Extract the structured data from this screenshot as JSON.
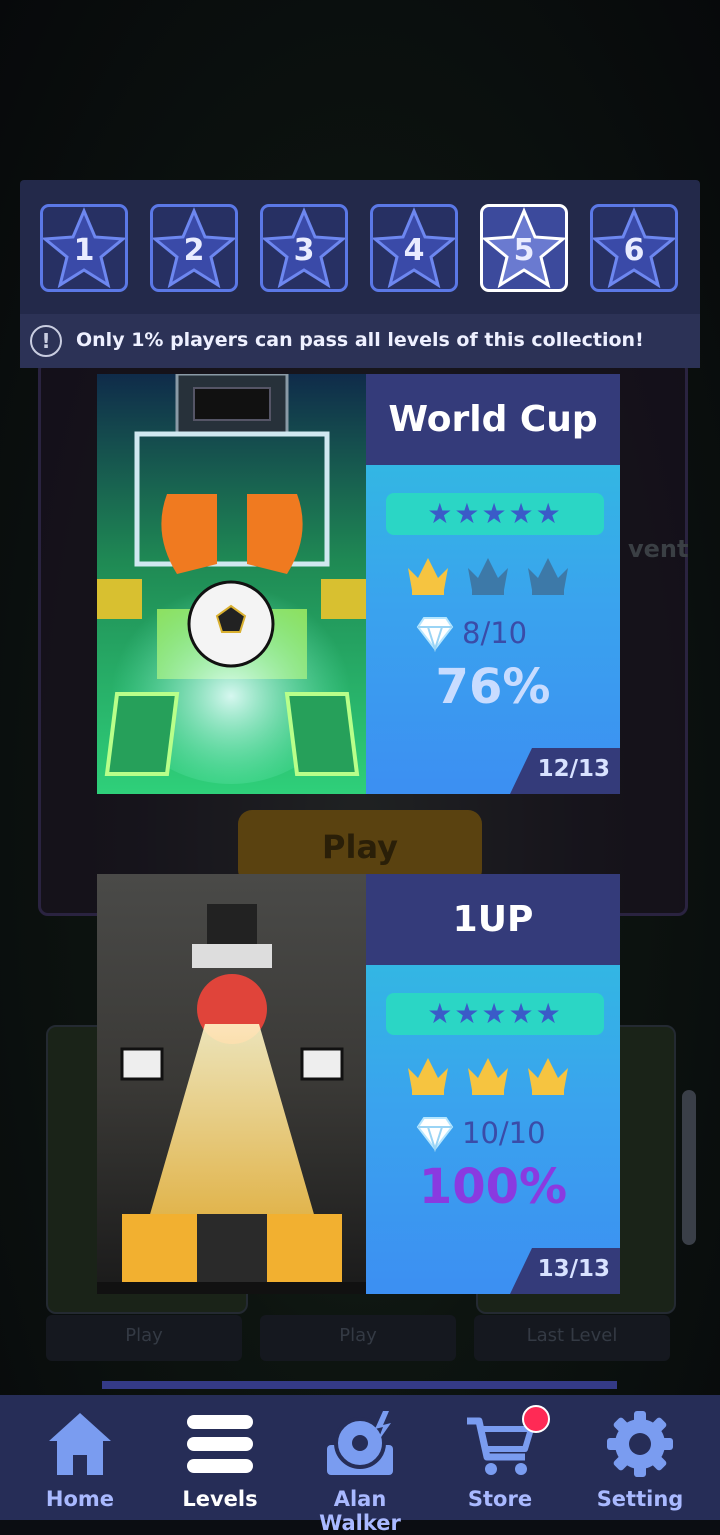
{
  "collections": {
    "tabs": [
      {
        "label": "1",
        "active": false
      },
      {
        "label": "2",
        "active": false
      },
      {
        "label": "3",
        "active": false
      },
      {
        "label": "4",
        "active": false
      },
      {
        "label": "5",
        "active": true
      },
      {
        "label": "6",
        "active": false
      }
    ],
    "notice": "Only 1%  players can pass all levels of this collection!"
  },
  "background": {
    "play_label": "Play",
    "event_label": "vent",
    "buttons": [
      "Play",
      "Play",
      "Last Level"
    ]
  },
  "levels": [
    {
      "title": "World Cup",
      "stars": "★★★★★",
      "crowns_earned": 1,
      "crowns_total": 3,
      "gems": "8/10",
      "percent": "76%",
      "percent_color": "#c8dcff",
      "progress": "12/13"
    },
    {
      "title": "1UP",
      "stars": "★★★★★",
      "crowns_earned": 3,
      "crowns_total": 3,
      "gems": "10/10",
      "percent": "100%",
      "percent_color": "#8a3ae0",
      "progress": "13/13"
    }
  ],
  "nav": {
    "items": [
      {
        "label": "Home",
        "icon": "home-icon",
        "active": false
      },
      {
        "label": "Levels",
        "icon": "list-icon",
        "active": true
      },
      {
        "label": "Alan Walker",
        "icon": "music-disc-icon",
        "active": false
      },
      {
        "label": "Store",
        "icon": "cart-icon",
        "active": false,
        "badge": true
      },
      {
        "label": "Setting",
        "icon": "gear-icon",
        "active": false
      }
    ]
  },
  "colors": {
    "accent": "#5b78e6",
    "nav_bg": "#262d57",
    "crown_gold": "#f6c440",
    "crown_empty": "#3d79a8",
    "badge": "#ff2a55"
  }
}
